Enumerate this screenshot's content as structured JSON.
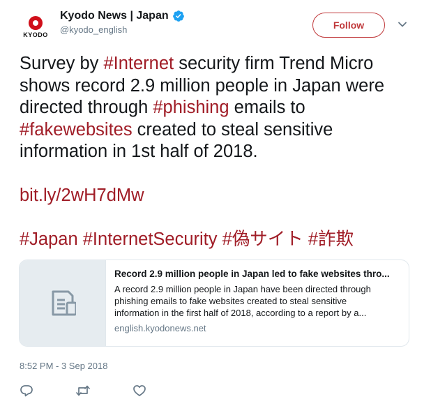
{
  "header": {
    "avatar_text": "KYODO",
    "display_name": "Kyodo News | Japan",
    "handle": "@kyodo_english",
    "follow_label": "Follow"
  },
  "tweet": {
    "text_lines": [
      [
        {
          "t": "Survey by "
        },
        {
          "t": "#Internet",
          "tag": true
        },
        {
          "t": " security firm Trend Micro"
        }
      ],
      [
        {
          "t": "shows record 2.9 million people in Japan were"
        }
      ],
      [
        {
          "t": "directed through "
        },
        {
          "t": "#phishing",
          "tag": true
        },
        {
          "t": " emails to"
        }
      ],
      [
        {
          "t": "#fakewebsites",
          "tag": true
        },
        {
          "t": " created to steal sensitive"
        }
      ],
      [
        {
          "t": "information in 1st half of 2018."
        }
      ]
    ],
    "link": "bit.ly/2wH7dMw",
    "hashtags": "#Japan #InternetSecurity #偽サイト #詐欺"
  },
  "card": {
    "title": "Record 2.9 million people in Japan led to fake websites thro...",
    "description_lines": [
      "A record 2.9 million people in Japan have been directed through",
      "phishing emails to fake websites created to steal sensitive",
      "information in the first half of 2018, according to a report by a..."
    ],
    "domain": "english.kyodonews.net",
    "thumb_icon": "document-icon"
  },
  "timestamp": "8:52 PM - 3 Sep 2018",
  "actions": {
    "reply_icon": "reply-icon",
    "retweet_icon": "retweet-icon",
    "like_icon": "heart-icon"
  },
  "colors": {
    "accent": "#a01d27",
    "follow_border": "#c0393b",
    "muted": "#657786",
    "verified": "#1da1f2",
    "brand_red": "#d00f1a"
  }
}
